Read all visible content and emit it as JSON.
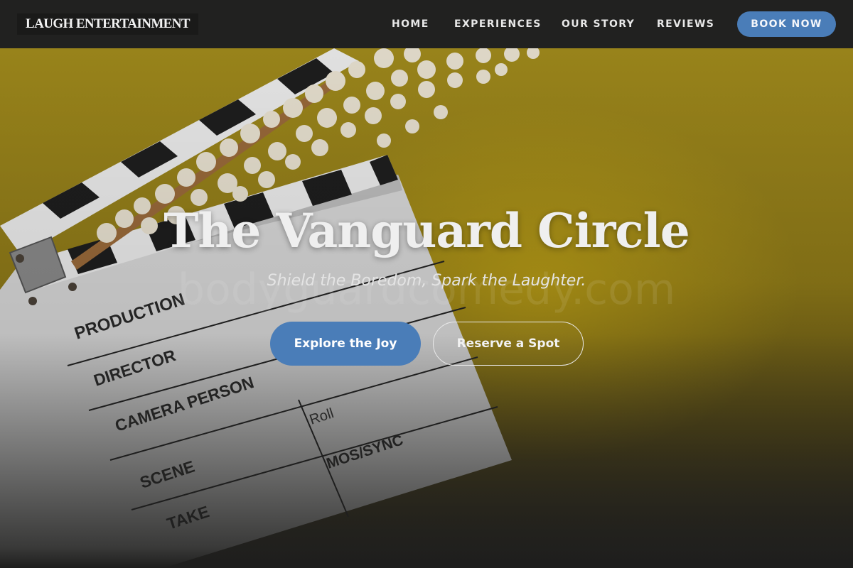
{
  "header": {
    "brand": "LAUGH ENTERTAINMENT",
    "nav": [
      {
        "label": "HOME"
      },
      {
        "label": "EXPERIENCES"
      },
      {
        "label": "OUR STORY"
      },
      {
        "label": "REVIEWS"
      }
    ],
    "book_label": "BOOK NOW"
  },
  "hero": {
    "title": "The Vanguard Circle",
    "subtitle": "Shield the Boredom, Spark the Laughter.",
    "watermark": "bodyguardcomedy.com",
    "primary_cta": "Explore the Joy",
    "secondary_cta": "Reserve a Spot",
    "background_image": {
      "depicts": "film clapperboard and popcorn on yellow background",
      "clapper_fields": [
        "PRODUCTION",
        "DIRECTOR",
        "CAMERA PERSON",
        "Roll",
        "SCENE",
        "MOS/SYNC",
        "TAKE"
      ]
    }
  },
  "colors": {
    "header_bg": "#212120",
    "accent": "#4a7db8",
    "hero_yellow": "#a08a1c",
    "text_light": "#efefef"
  }
}
